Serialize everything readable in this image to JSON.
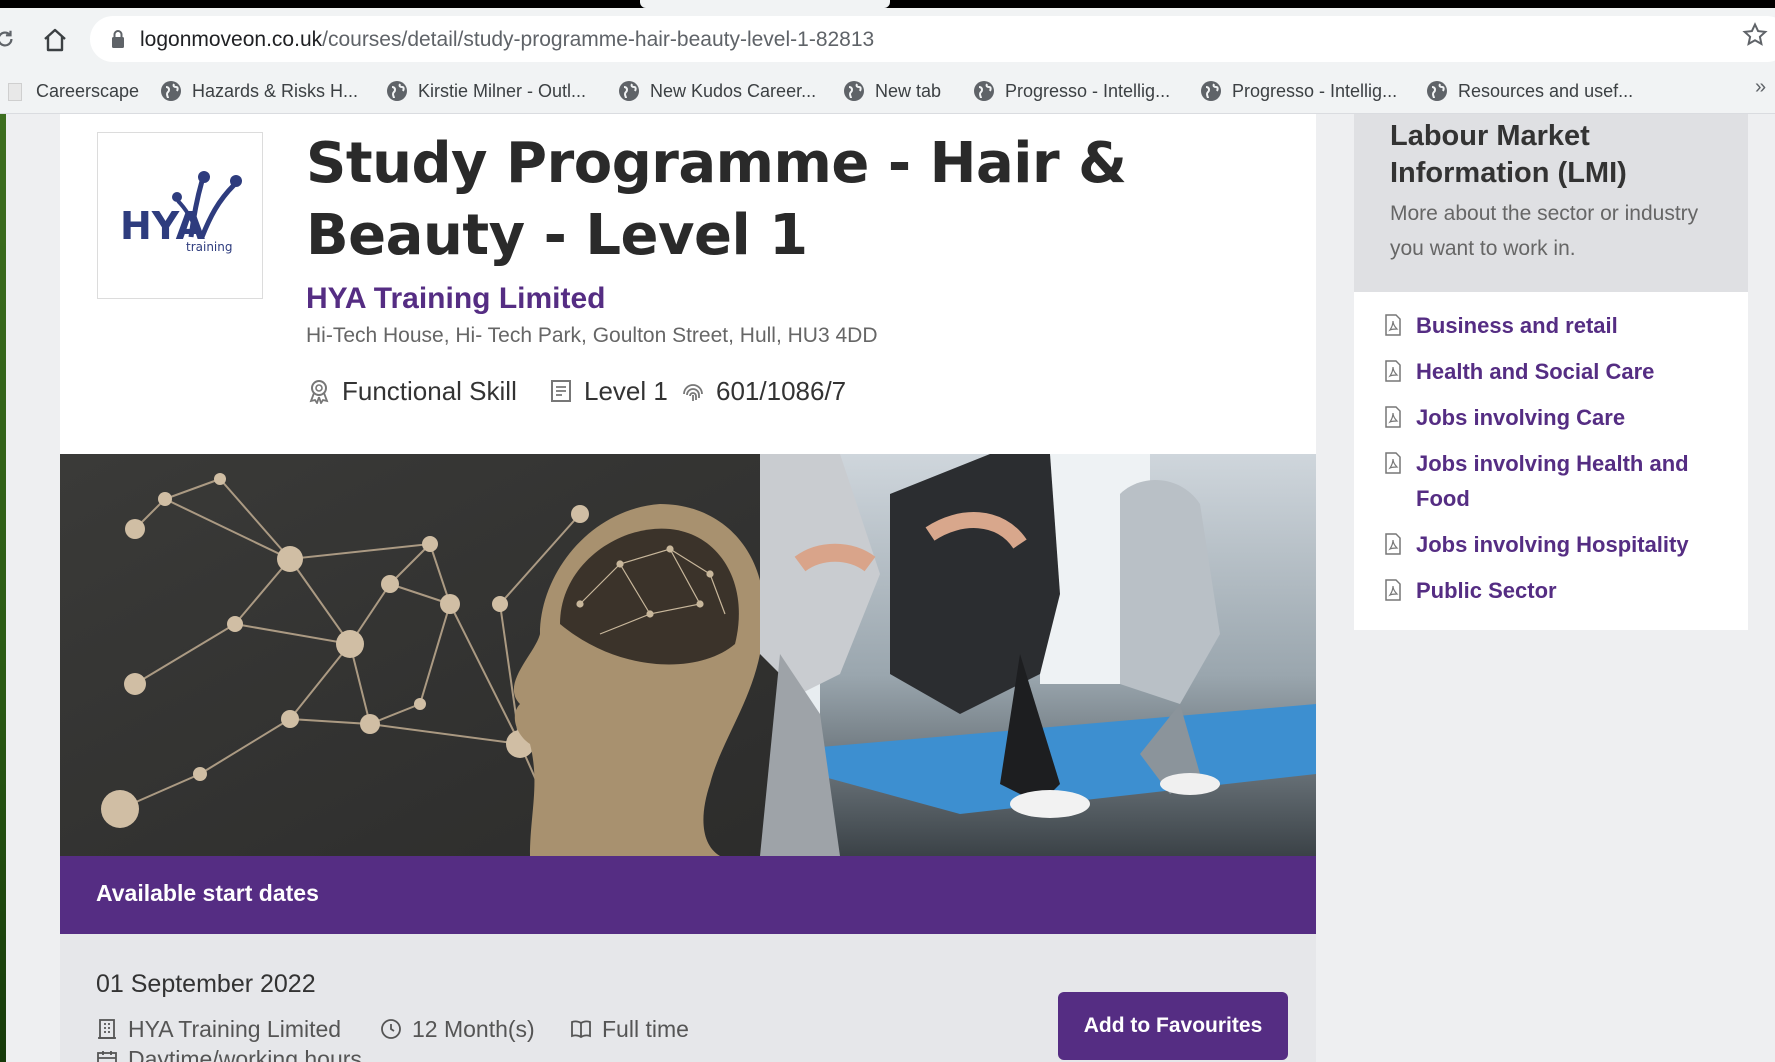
{
  "browser": {
    "url_host": "logonmoveon.co.uk",
    "url_path": "/courses/detail/study-programme-hair-beauty-level-1-82813",
    "bookmarks": [
      {
        "label": "Careerscape"
      },
      {
        "label": "Hazards & Risks  H..."
      },
      {
        "label": "Kirstie Milner - Outl..."
      },
      {
        "label": "New Kudos Career..."
      },
      {
        "label": "New tab"
      },
      {
        "label": "Progresso - Intellig..."
      },
      {
        "label": "Progresso - Intellig..."
      },
      {
        "label": "Resources and usef..."
      }
    ],
    "more_label": "»"
  },
  "course": {
    "title": "Study Programme - Hair & Beauty - Level 1",
    "provider": "HYA Training Limited",
    "address": "Hi-Tech House, Hi- Tech Park, Goulton Street, Hull, HU3 4DD",
    "qualification_type": "Functional Skill",
    "level": "Level 1",
    "qan": "601/1086/7",
    "logo_text": "HYA",
    "logo_subtext": "training"
  },
  "dates": {
    "heading": "Available start dates",
    "start_date": "01 September 2022",
    "provider": "HYA Training Limited",
    "duration": "12 Month(s)",
    "attendance": "Full time",
    "hours": "Daytime/working hours",
    "favourite_button": "Add to Favourites"
  },
  "lmi": {
    "title": "Labour Market Information (LMI)",
    "subtitle": "More about the sector or industry you want to work in.",
    "items": [
      "Business and retail",
      "Health and Social Care",
      "Jobs involving Care",
      "Jobs involving Health and Food",
      "Jobs involving Hospitality",
      "Public Sector"
    ]
  },
  "colors": {
    "brand_purple": "#552d83",
    "page_bg": "#eeeff1"
  }
}
